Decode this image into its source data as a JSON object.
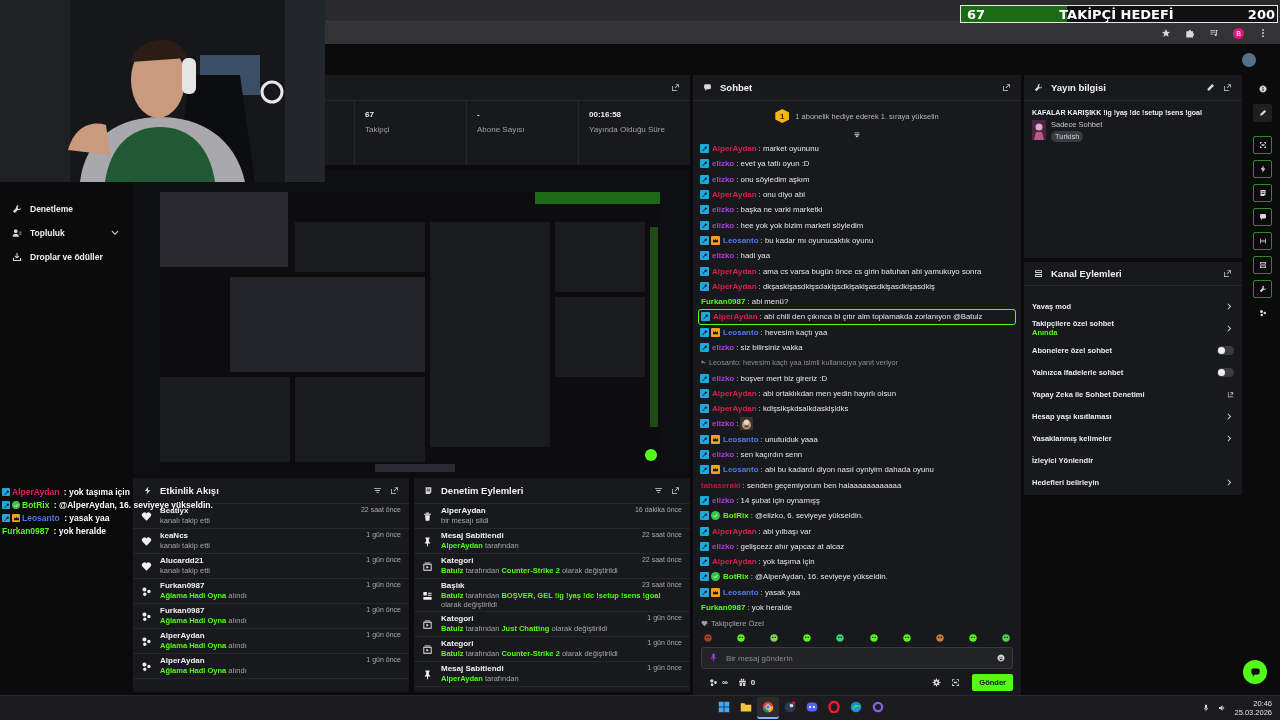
{
  "browser": {
    "profile_initial": "B"
  },
  "follower_goal": {
    "current": "67",
    "label": "TAKİPÇİ HEDEFİ",
    "target": "200",
    "level": 0.335
  },
  "sidebar": {
    "items": [
      {
        "label": "Denetleme",
        "kind": "wrench",
        "expandable": false
      },
      {
        "label": "Topluluk",
        "kind": "people",
        "expandable": true
      },
      {
        "label": "Droplar ve ödüller",
        "kind": "drops",
        "expandable": false
      }
    ]
  },
  "stats": [
    {
      "value": "67",
      "label": "Takipçi"
    },
    {
      "value": "-",
      "label": "Abone Sayısı"
    },
    {
      "value": "00:16:58",
      "label": "Yayında Olduğu Süre"
    }
  ],
  "overlay_chat": [
    {
      "user": "AlperAydan",
      "color": "#e0245e",
      "badges": [
        {
          "kind": "mod"
        }
      ],
      "text": " : yok taşıma için"
    },
    {
      "user": "BotRix",
      "color": "#53fc18",
      "badges": [
        {
          "kind": "mod"
        },
        {
          "kind": "verified"
        }
      ],
      "text": " : @AlperAydan, 16. seviyeye yükseldin."
    },
    {
      "user": "Leosanto",
      "color": "#4f7bea",
      "badges": [
        {
          "kind": "mod"
        },
        {
          "kind": "vip"
        }
      ],
      "text": " : yasak yaa"
    },
    {
      "user": "Furkan0987",
      "color": "#53fc18",
      "text": " : yok heralde"
    }
  ],
  "activity": {
    "title": "Etkinlik Akışı",
    "events": [
      {
        "kind": "follow",
        "name": "Beatlyx",
        "time": "22 saat önce",
        "detail": "kanalı takip etti"
      },
      {
        "kind": "follow",
        "name": "keaNcs",
        "time": "1 gün önce",
        "detail": "kanalı takip etti"
      },
      {
        "kind": "follow",
        "name": "Alucardd21",
        "time": "1 gün önce",
        "detail": "kanalı takip etti"
      },
      {
        "kind": "reward",
        "name": "Furkan0987",
        "time": "1 gün önce",
        "detail": "**Ağlama Hadi Oyna** alındı"
      },
      {
        "kind": "reward",
        "name": "Furkan0987",
        "time": "1 gün önce",
        "detail": "**Ağlama Hadi Oyna** alındı"
      },
      {
        "kind": "reward",
        "name": "AlperAydan",
        "time": "1 gün önce",
        "detail": "**Ağlama Hadi Oyna** alındı"
      },
      {
        "kind": "reward",
        "name": "AlperAydan",
        "time": "1 gün önce",
        "detail": "**Ağlama Hadi Oyna** alındı"
      }
    ]
  },
  "mod_actions": {
    "title": "Denetim Eylemleri",
    "actions": [
      {
        "kind": "delete",
        "title": "AlperAydan",
        "time": "16 dakika önce",
        "detail": "bir mesajı sildi"
      },
      {
        "kind": "pin",
        "title": "Mesaj Sabitlendi",
        "time": "22 saat önce",
        "detail": "**AlperAydan** tarafından"
      },
      {
        "kind": "category",
        "title": "Kategori",
        "time": "22 saat önce",
        "detail": "**Batulz** tarafından **Counter-Strike 2** olarak değiştirildi"
      },
      {
        "kind": "title",
        "title": "Başlık",
        "time": "23 saat önce",
        "detail": "**Batulz** tarafından **BOŞVER, GEL !ig !yaş !dc !setup !sens !goal** olarak değiştirildi"
      },
      {
        "kind": "category",
        "title": "Kategori",
        "time": "1 gün önce",
        "detail": "**Batulz** tarafından **Just Chatting** olarak değiştirildi"
      },
      {
        "kind": "category",
        "title": "Kategori",
        "time": "1 gün önce",
        "detail": "**Batulz** tarafından **Counter-Strike 2** olarak değiştirildi"
      },
      {
        "kind": "pin",
        "title": "Mesaj Sabitlendi",
        "time": "1 gün önce",
        "detail": "**AlperAydan** tarafından"
      }
    ]
  },
  "chat": {
    "title": "Sohbet",
    "gift_rank": "1",
    "gift_text": "1 abonelik hediye ederek 1. sıraya yükselin",
    "messages": [
      {
        "kind": "message",
        "user": "AlperAydan",
        "color": "#d9214f",
        "badges": [
          {
            "kind": "mod"
          }
        ],
        "text": ": market oyununu",
        "highlighted": false
      },
      {
        "kind": "message",
        "user": "elizko",
        "color": "#b13be0",
        "badges": [
          {
            "kind": "mod"
          }
        ],
        "text": ": evet ya tatlı oyun :D",
        "highlighted": false
      },
      {
        "kind": "message",
        "user": "elizko",
        "color": "#b13be0",
        "badges": [
          {
            "kind": "mod"
          }
        ],
        "text": ": onu söyledim aşkım",
        "highlighted": false
      },
      {
        "kind": "message",
        "user": "AlperAydan",
        "color": "#d9214f",
        "badges": [
          {
            "kind": "mod"
          }
        ],
        "text": ": onu diyo abi",
        "highlighted": false
      },
      {
        "kind": "message",
        "user": "elizko",
        "color": "#b13be0",
        "badges": [
          {
            "kind": "mod"
          }
        ],
        "text": ": başka ne varki marketki",
        "highlighted": false
      },
      {
        "kind": "message",
        "user": "elizko",
        "color": "#b13be0",
        "badges": [
          {
            "kind": "mod"
          }
        ],
        "text": ": hee yok yok bizim marketi söyledim",
        "highlighted": false
      },
      {
        "kind": "message",
        "user": "Leosanto",
        "color": "#4f7bea",
        "badges": [
          {
            "kind": "mod"
          },
          {
            "kind": "vip"
          }
        ],
        "text": ": bu kadar mı oyunucaktık oyunu",
        "highlighted": false
      },
      {
        "kind": "message",
        "user": "elizko",
        "color": "#b13be0",
        "badges": [
          {
            "kind": "mod"
          }
        ],
        "text": ": hadi yaa",
        "highlighted": false
      },
      {
        "kind": "message",
        "user": "AlperAydan",
        "color": "#d9214f",
        "badges": [
          {
            "kind": "mod"
          }
        ],
        "text": ": ama cs varsa bugün önce cs girin batuhan abi yamukuyo sonra",
        "highlighted": false
      },
      {
        "kind": "message",
        "user": "AlperAydan",
        "color": "#d9214f",
        "badges": [
          {
            "kind": "mod"
          }
        ],
        "text": ": dkşaskişasdkişsdakişsdkişakişasdkişasdkişasdkiş",
        "highlighted": false
      },
      {
        "kind": "message",
        "user": "Furkan0987",
        "color": "#53fc18",
        "text": ": abi menü?",
        "highlighted": false
      },
      {
        "kind": "message",
        "user": "AlperAydan",
        "color": "#d9214f",
        "badges": [
          {
            "kind": "mod"
          }
        ],
        "text": ": abi chill den çıkınca bi çıtır alm toplamakda zorlanıyon @Batulz",
        "highlighted": true
      },
      {
        "kind": "message",
        "user": "Leosanto",
        "color": "#4f7bea",
        "badges": [
          {
            "kind": "mod"
          },
          {
            "kind": "vip"
          }
        ],
        "text": ": hevesim kaçtı yaa",
        "highlighted": false
      },
      {
        "kind": "message",
        "user": "elizko",
        "color": "#b13be0",
        "badges": [
          {
            "kind": "mod"
          }
        ],
        "text": ": siz bilirsiniz vakka",
        "highlighted": false
      },
      {
        "kind": "reply",
        "text": "Leosanto: hevesim kaçtı yaa isimli kullanıcıya yanıt veriyor",
        "highlighted": false
      },
      {
        "kind": "message",
        "user": "elizko",
        "color": "#b13be0",
        "badges": [
          {
            "kind": "mod"
          }
        ],
        "text": ": boşver mert biz gireriz :D",
        "highlighted": false
      },
      {
        "kind": "message",
        "user": "AlperAydan",
        "color": "#d9214f",
        "badges": [
          {
            "kind": "mod"
          }
        ],
        "text": ": abi ortaklıkdan men yedin hayırlı olsun",
        "highlighted": false
      },
      {
        "kind": "message",
        "user": "AlperAydan",
        "color": "#d9214f",
        "badges": [
          {
            "kind": "mod"
          }
        ],
        "text": ": kdlşslkşkdsalkdaskişldks",
        "highlighted": false
      },
      {
        "kind": "emote",
        "user": "elizko",
        "color": "#b13be0",
        "badges": [
          {
            "kind": "mod"
          }
        ],
        "text": ":",
        "highlighted": false
      },
      {
        "kind": "message",
        "user": "Leosanto",
        "color": "#4f7bea",
        "badges": [
          {
            "kind": "mod"
          },
          {
            "kind": "vip"
          }
        ],
        "text": ": unutulduk yaaa",
        "highlighted": false
      },
      {
        "kind": "message",
        "user": "elizko",
        "color": "#b13be0",
        "badges": [
          {
            "kind": "mod"
          }
        ],
        "text": ": sen kaçırdın senn",
        "highlighted": false
      },
      {
        "kind": "message",
        "user": "Leosanto",
        "color": "#4f7bea",
        "badges": [
          {
            "kind": "mod"
          },
          {
            "kind": "vip"
          }
        ],
        "text": ": abi bu kadardı diyon nasıl oyniyim dahada oyunu",
        "highlighted": false
      },
      {
        "kind": "message",
        "user": "tahaseraki",
        "color": "#c4183b",
        "text": ": senden geçemiyorum ben halaaaaaaaaaaaa",
        "highlighted": false
      },
      {
        "kind": "message",
        "user": "elizko",
        "color": "#b13be0",
        "badges": [
          {
            "kind": "mod"
          }
        ],
        "text": ": 14 şubat için oynamışş",
        "highlighted": false
      },
      {
        "kind": "message",
        "user": "BotRix",
        "color": "#53fc18",
        "badges": [
          {
            "kind": "mod"
          },
          {
            "kind": "verified"
          }
        ],
        "text": ": @elizko, 6. seviyeye yükseldin.",
        "highlighted": false
      },
      {
        "kind": "message",
        "user": "AlperAydan",
        "color": "#d9214f",
        "badges": [
          {
            "kind": "mod"
          }
        ],
        "text": ": abi yılbaşı var",
        "highlighted": false
      },
      {
        "kind": "message",
        "user": "elizko",
        "color": "#b13be0",
        "badges": [
          {
            "kind": "mod"
          }
        ],
        "text": ": gelişcezz ahır yapcaz at alcaz",
        "highlighted": false
      },
      {
        "kind": "message",
        "user": "AlperAydan",
        "color": "#d9214f",
        "badges": [
          {
            "kind": "mod"
          }
        ],
        "text": ": yok taşıma için",
        "highlighted": false
      },
      {
        "kind": "message",
        "user": "BotRix",
        "color": "#53fc18",
        "badges": [
          {
            "kind": "mod"
          },
          {
            "kind": "verified"
          }
        ],
        "text": ": @AlperAydan, 16. seviyeye yükseldin.",
        "highlighted": false
      },
      {
        "kind": "message",
        "user": "Leosanto",
        "color": "#4f7bea",
        "badges": [
          {
            "kind": "mod"
          },
          {
            "kind": "vip"
          }
        ],
        "text": ": yasak yaa",
        "highlighted": false
      },
      {
        "kind": "message",
        "user": "Furkan0987",
        "color": "#53fc18",
        "text": ": yok heralde",
        "highlighted": false
      }
    ],
    "emotes_label": "Takipçilere Özel",
    "emotes": [
      {
        "color": "#a0412b"
      },
      {
        "color": "#53fc18"
      },
      {
        "color": "#7ed957"
      },
      {
        "color": "#53fc18"
      },
      {
        "color": "#3ecf6e"
      },
      {
        "color": "#53fc18"
      },
      {
        "color": "#53fc18"
      },
      {
        "color": "#c77a3a"
      },
      {
        "color": "#53fc18"
      },
      {
        "color": "#4bd64b"
      }
    ],
    "placeholder": "Bir mesaj gönderin",
    "points": "∞",
    "gifts": "0",
    "send": "Gönder"
  },
  "stream_info": {
    "title": "Yayın bilgisi",
    "stream_title": "KAFALAR KARIŞIKK !ig !yaş !dc !setup !sens !goal",
    "category": "Sadece Sohbet",
    "tag": "Turkish"
  },
  "channel_actions": {
    "title": "Kanal Eylemleri",
    "rows": [
      {
        "label": "Yavaş mod",
        "kind": "link"
      },
      {
        "label": "Takipçilere özel sohbet",
        "sub": "Anında",
        "kind": "link"
      },
      {
        "label": "Abonelere özel sohbet",
        "kind": "toggle",
        "on": false
      },
      {
        "label": "Yalnızca ifadelerle sohbet",
        "kind": "toggle",
        "on": false
      },
      {
        "label": "Yapay Zeka ile Sohbet Denetimi",
        "kind": "external"
      },
      {
        "label": "Hesap yaşı kısıtlaması",
        "kind": "link"
      },
      {
        "label": "Yasaklanmış kelimeler",
        "kind": "link"
      },
      {
        "label": "İzleyici Yönlendir",
        "kind": "plain"
      },
      {
        "label": "Hedefleri belirleyin",
        "kind": "link"
      }
    ]
  },
  "rail": [
    {
      "kind": "info",
      "active": false
    },
    {
      "kind": "pencil",
      "active": false
    },
    {
      "kind": "scan",
      "active": true
    },
    {
      "kind": "bolt",
      "active": true
    },
    {
      "kind": "note",
      "active": true
    },
    {
      "kind": "chat",
      "active": true
    },
    {
      "kind": "split",
      "active": true
    },
    {
      "kind": "layout",
      "active": true
    },
    {
      "kind": "wrench",
      "active": true
    },
    {
      "kind": "dots",
      "active": false
    }
  ],
  "taskbar": {
    "apps": [
      {
        "kind": "start",
        "selected": false
      },
      {
        "kind": "folder",
        "selected": false
      },
      {
        "kind": "browser",
        "selected": true
      },
      {
        "kind": "steam",
        "selected": false
      },
      {
        "kind": "discord",
        "selected": false
      },
      {
        "kind": "opera",
        "selected": false
      },
      {
        "kind": "edge",
        "selected": false
      },
      {
        "kind": "ring",
        "selected": false
      }
    ],
    "time": "20:46",
    "date": "25.03.2026"
  }
}
